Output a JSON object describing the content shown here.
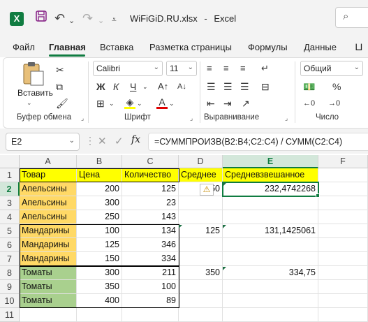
{
  "titlebar": {
    "filename": "WiFiGiD.RU.xlsx",
    "separator": "-",
    "app": "Excel"
  },
  "tabs": [
    "Файл",
    "Главная",
    "Вставка",
    "Разметка страницы",
    "Формулы",
    "Данные"
  ],
  "ribbon": {
    "clipboard_label": "Буфер обмена",
    "paste_label": "Вставить",
    "font_label": "Шрифт",
    "font_name": "Calibri",
    "font_size": "11",
    "bold": "Ж",
    "italic": "К",
    "underline": "Ч",
    "align_label": "Выравнивание",
    "number_label": "Число",
    "number_format": "Общий"
  },
  "formula_bar": {
    "name_box": "E2",
    "fx": "fx",
    "formula": "=СУММПРОИЗВ(B2:B4;C2:C4) / СУММ(C2:C4)"
  },
  "grid": {
    "columns": [
      "A",
      "B",
      "C",
      "D",
      "E",
      "F"
    ],
    "rows": [
      "1",
      "2",
      "3",
      "4",
      "5",
      "6",
      "7",
      "8",
      "9",
      "10",
      "11"
    ],
    "cells": {
      "A1": "Товар",
      "B1": "Цена",
      "C1": "Количество",
      "D1": "Среднее",
      "E1": "Средневзвешанное",
      "A2": "Апельсины",
      "B2": "200",
      "C2": "125",
      "D2": "150",
      "E2": "232,4742268",
      "A3": "Апельсины",
      "B3": "300",
      "C3": "23",
      "A4": "Апельсины",
      "B4": "250",
      "C4": "143",
      "A5": "Мандарины",
      "B5": "100",
      "C5": "134",
      "D5": "125",
      "E5": "131,1425061",
      "A6": "Мандарины",
      "B6": "125",
      "C6": "346",
      "A7": "Мандарины",
      "B7": "150",
      "C7": "334",
      "A8": "Томаты",
      "B8": "300",
      "C8": "211",
      "D8": "350",
      "E8": "334,75",
      "A9": "Томаты",
      "B9": "350",
      "C9": "100",
      "A10": "Томаты",
      "B10": "400",
      "C10": "89"
    }
  },
  "colors": {
    "header_fill": "#ffff00",
    "mandarin_fill": "#ffd966",
    "tomato_fill": "#a9d08e",
    "accent": "#107c41"
  }
}
